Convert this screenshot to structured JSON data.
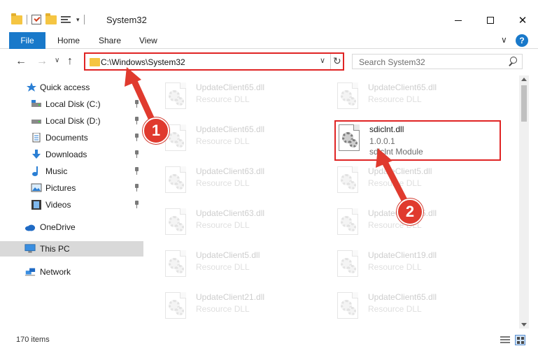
{
  "window": {
    "title": "System32",
    "min_label": "—",
    "max_label": "",
    "close_label": "✕"
  },
  "ribbon": {
    "file": "File",
    "home": "Home",
    "share": "Share",
    "view": "View",
    "chevron": "∨",
    "help": "?"
  },
  "nav": {
    "back": "←",
    "forward": "→",
    "recent": "∨",
    "up": "↑",
    "address": "C:\\Windows\\System32",
    "address_dropdown": "∨",
    "refresh": "↻",
    "search_placeholder": "Search System32"
  },
  "sidebar": {
    "items": [
      {
        "label": "Quick access"
      },
      {
        "label": "Local Disk (C:)"
      },
      {
        "label": "Local Disk (D:)"
      },
      {
        "label": "Documents"
      },
      {
        "label": "Downloads"
      },
      {
        "label": "Music"
      },
      {
        "label": "Pictures"
      },
      {
        "label": "Videos"
      },
      {
        "label": "OneDrive"
      },
      {
        "label": "This PC"
      },
      {
        "label": "Network"
      }
    ]
  },
  "files": [
    {
      "name": "UpdateClient65.dll",
      "type": "Resource DLL"
    },
    {
      "name": "UpdateClient65.dll",
      "type": "Resource DLL"
    },
    {
      "name": "UpdateClient65.dll",
      "type": "Resource DLL"
    },
    {
      "name": "sdiclnt.dll",
      "type": "1.0.0.1",
      "desc": "sdiclnt Module"
    },
    {
      "name": "UpdateClient63.dll",
      "type": "Resource DLL"
    },
    {
      "name": "UpdateClient5.dll",
      "type": "Resource DLL"
    },
    {
      "name": "UpdateClient63.dll",
      "type": "Resource DLL"
    },
    {
      "name": "UpdateClient65.dll",
      "type": "Resource DLL"
    },
    {
      "name": "UpdateClient5.dll",
      "type": "Resource DLL"
    },
    {
      "name": "UpdateClient19.dll",
      "type": "Resource DLL"
    },
    {
      "name": "UpdateClient21.dll",
      "type": "Resource DLL"
    },
    {
      "name": "UpdateClient65.dll",
      "type": "Resource DLL"
    }
  ],
  "status": {
    "items_count": "170 items"
  },
  "callouts": {
    "one": "1",
    "two": "2"
  },
  "colors": {
    "accent": "#1979ca",
    "highlight_red": "#e02424",
    "callout_red": "#e03a2e",
    "folder_yellow": "#f5c542"
  }
}
